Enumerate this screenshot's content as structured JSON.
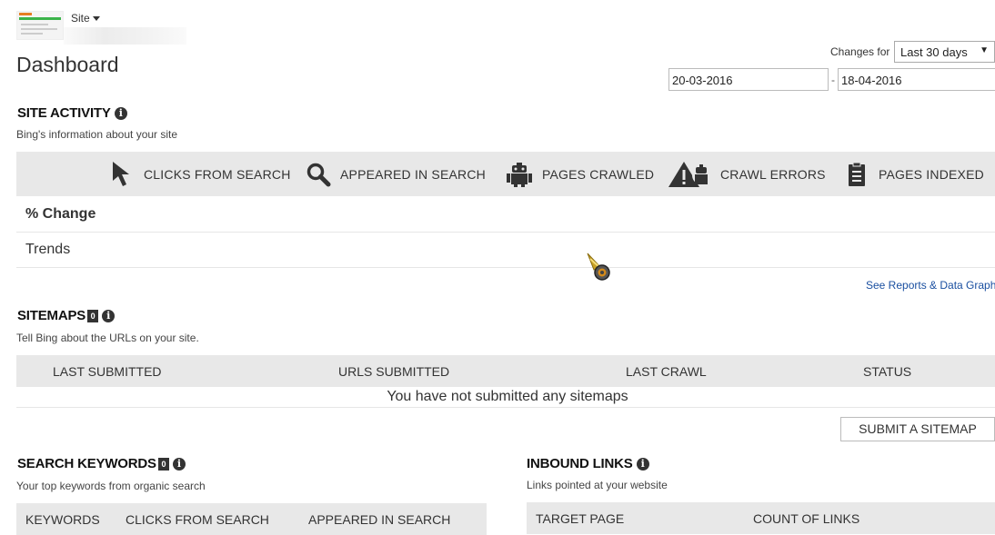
{
  "header": {
    "site_label": "Site",
    "page_title": "Dashboard",
    "changes_for_label": "Changes for",
    "range": "Last 30 days",
    "date_from": "20-03-2016",
    "date_sep": "-",
    "date_to": "18-04-2016"
  },
  "site_activity": {
    "title": "SITE ACTIVITY",
    "subtitle": "Bing's information about your site",
    "metrics": [
      {
        "label": "CLICKS FROM SEARCH",
        "icon": "cursor-arrow-icon"
      },
      {
        "label": "APPEARED IN SEARCH",
        "icon": "magnifier-icon"
      },
      {
        "label": "PAGES CRAWLED",
        "icon": "robot-icon"
      },
      {
        "label": "CRAWL ERRORS",
        "icon": "warning-robot-icon"
      },
      {
        "label": "PAGES INDEXED",
        "icon": "clipboard-icon"
      }
    ],
    "row_pct_change": "% Change",
    "row_trends": "Trends",
    "see_reports": "See Reports & Data Graph"
  },
  "sitemaps": {
    "title": "SITEMAPS",
    "count": "0",
    "subtitle": "Tell Bing about the URLs on your site.",
    "columns": [
      "LAST SUBMITTED",
      "URLS SUBMITTED",
      "LAST CRAWL",
      "STATUS"
    ],
    "empty_message": "You have not submitted any sitemaps",
    "submit_button": "SUBMIT A SITEMAP"
  },
  "search_keywords": {
    "title": "SEARCH KEYWORDS",
    "count": "0",
    "subtitle": "Your top keywords from organic search",
    "columns": [
      "KEYWORDS",
      "CLICKS FROM SEARCH",
      "APPEARED IN SEARCH"
    ]
  },
  "inbound_links": {
    "title": "INBOUND LINKS",
    "subtitle": "Links pointed at your website",
    "columns": [
      "TARGET PAGE",
      "COUNT OF LINKS"
    ]
  },
  "info_glyph": "i"
}
